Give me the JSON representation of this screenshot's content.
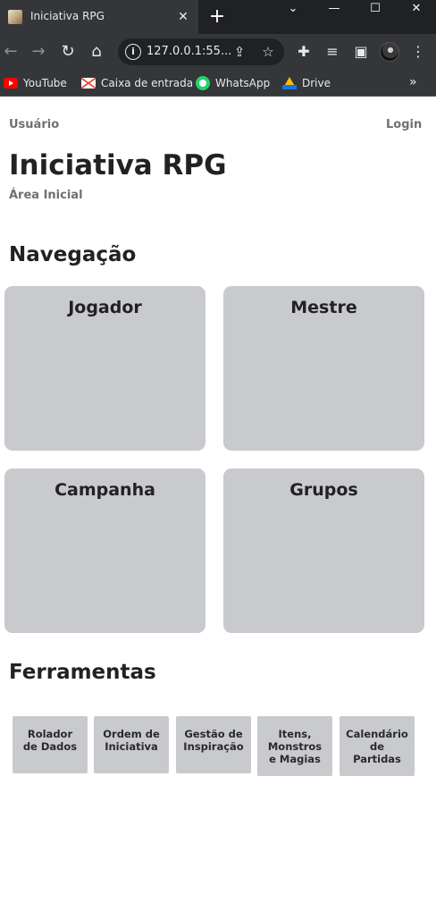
{
  "browser": {
    "tab_title": "Iniciativa RPG",
    "tab_close": "✕",
    "new_tab": "+",
    "window_controls": [
      "⌄",
      "—",
      "☐",
      "✕"
    ],
    "url": "127.0.0.1:55...",
    "bookmarks": [
      {
        "label": "YouTube",
        "icon": "youtube-icon"
      },
      {
        "label": "Caixa de entrada",
        "icon": "gmail-icon"
      },
      {
        "label": "WhatsApp",
        "icon": "whatsapp-icon"
      },
      {
        "label": "Drive",
        "icon": "drive-icon"
      }
    ],
    "bookmarks_more": "»"
  },
  "header": {
    "user_link": "Usuário",
    "login_link": "Login",
    "title": "Iniciativa RPG",
    "subtitle": "Área Inicial"
  },
  "navigation": {
    "heading": "Navegação",
    "cards": [
      "Jogador",
      "Mestre",
      "Campanha",
      "Grupos"
    ]
  },
  "tools": {
    "heading": "Ferramentas",
    "items": [
      "Rolador\nde Dados",
      "Ordem de\nIniciativa",
      "Gestão de\nInspiração",
      "Itens,\nMonstros\ne Magias",
      "Calendário\nde\nPartidas"
    ]
  },
  "colors": {
    "card_bg": "#c9cacd",
    "text_dark": "#222222",
    "text_muted": "#707070",
    "chrome_dark": "#202124",
    "chrome_toolbar": "#35363a"
  }
}
